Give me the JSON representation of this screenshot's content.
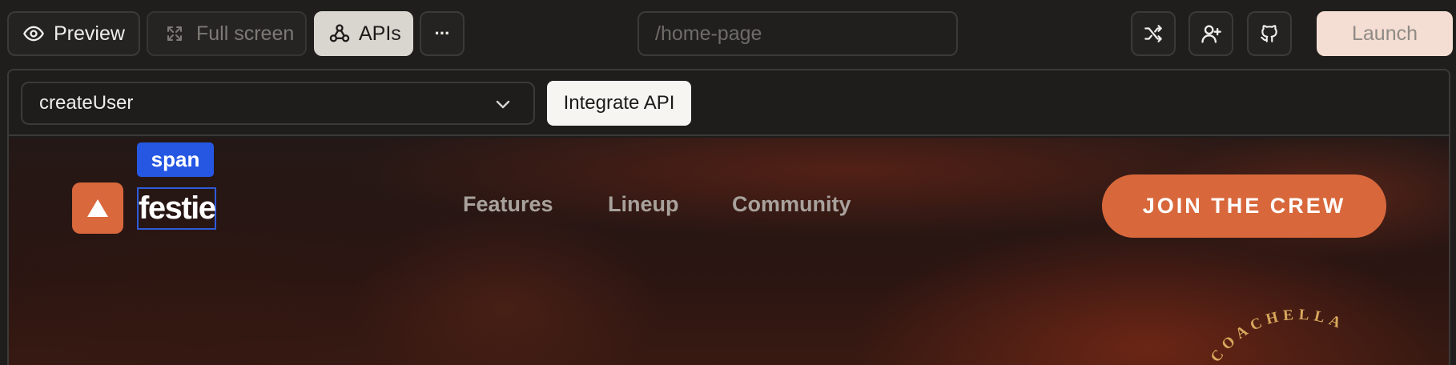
{
  "toolbar": {
    "preview_label": "Preview",
    "fullscreen_label": "Full screen",
    "apis_label": "APIs",
    "more_label": "···",
    "url_placeholder": "/home-page",
    "launch_label": "Launch",
    "icons": [
      "eye-icon",
      "expand-icon",
      "webhook-icon",
      "more-icon",
      "shuffle-icon",
      "user-plus-icon",
      "github-icon"
    ]
  },
  "api_panel": {
    "selected_api": "createUser",
    "integrate_label": "Integrate API"
  },
  "site": {
    "selection_tag": "span",
    "brand": "festie",
    "nav": [
      "Features",
      "Lineup",
      "Community"
    ],
    "cta": "JOIN THE CREW",
    "badge_arc_text": "COACHELLA",
    "colors": {
      "accent": "#d8683c",
      "selection": "#2557e3"
    }
  }
}
